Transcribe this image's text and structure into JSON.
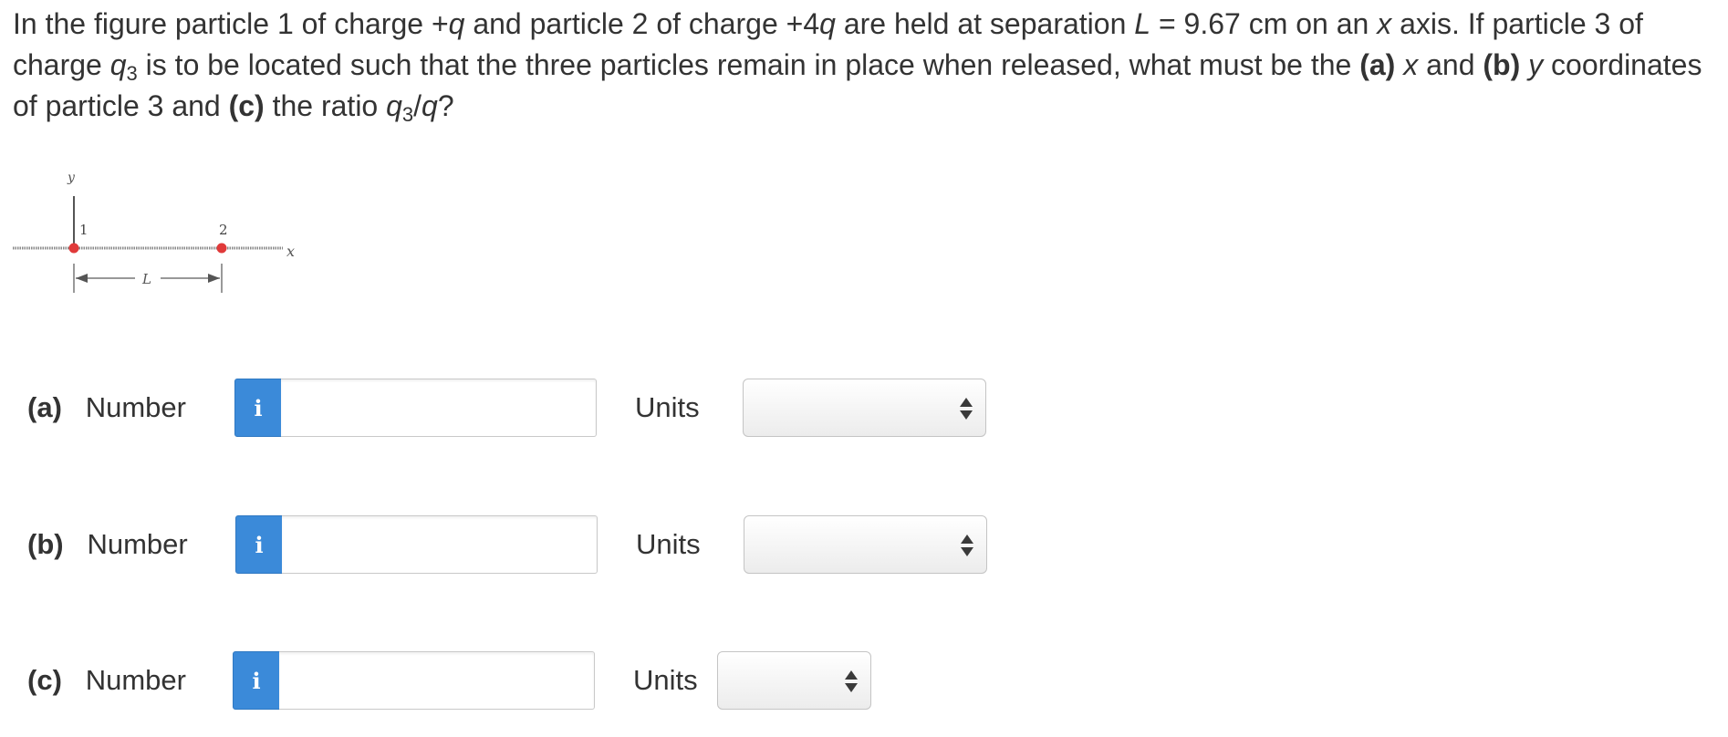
{
  "question": {
    "t1": "In the figure particle 1 of charge +",
    "q1": "q",
    "t2": " and particle 2 of charge +4",
    "q2": "q",
    "t3": " are held at separation ",
    "L": "L",
    "t4": " = 9.67 cm on an ",
    "x1": "x",
    "t5": " axis. If particle 3 of charge ",
    "q3": "q",
    "sub3": "3",
    "t6": " is to be located such that the three particles remain in place when released, what must be the ",
    "a": "(a)",
    "t7": " ",
    "x2": "x",
    "t8": " and ",
    "b": "(b)",
    "t9": " ",
    "y": "y",
    "t10": " coordinates of particle 3 and ",
    "c": "(c)",
    "t11": " the ratio ",
    "q4": "q",
    "sub4": "3",
    "slash": "/",
    "q5": "q",
    "t12": "?"
  },
  "figure": {
    "y_axis_label": "y",
    "x_axis_label": "x",
    "particle1_label": "1",
    "particle2_label": "2",
    "separation_label": "L",
    "particle_color": "#e03a3a"
  },
  "parts": [
    {
      "letter": "(a)",
      "label": "Number",
      "info": "i",
      "value": "",
      "units_label": "Units",
      "units_value": ""
    },
    {
      "letter": "(b)",
      "label": "Number",
      "info": "i",
      "value": "",
      "units_label": "Units",
      "units_value": ""
    },
    {
      "letter": "(c)",
      "label": "Number",
      "info": "i",
      "value": "",
      "units_label": "Units",
      "units_value": ""
    }
  ],
  "colors": {
    "info_button": "#3b8ad9",
    "text": "#333333"
  }
}
